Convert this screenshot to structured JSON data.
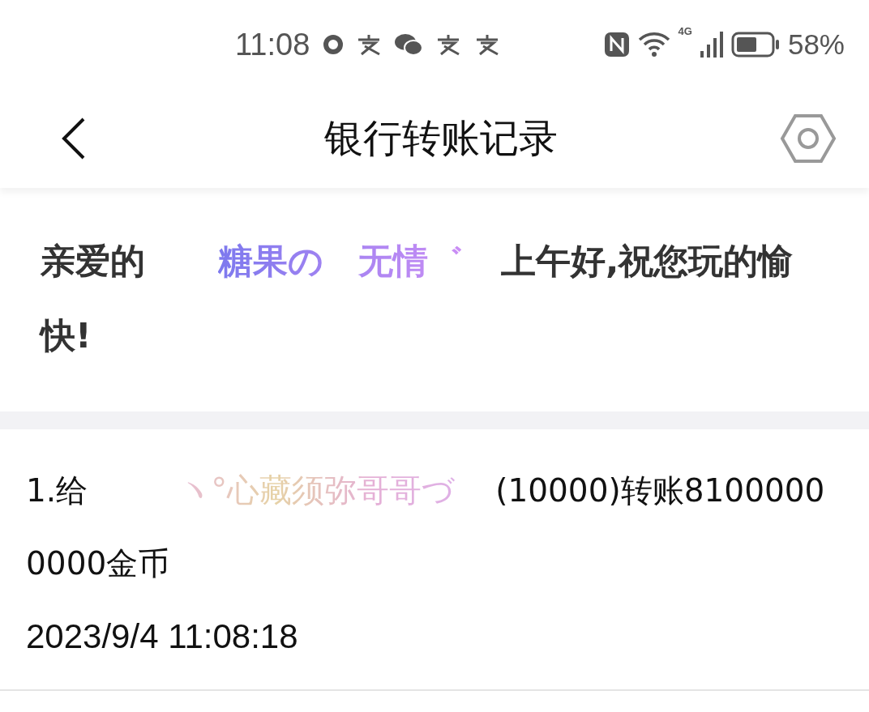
{
  "status_bar": {
    "time": "11:08",
    "battery": "58%",
    "network": "4G"
  },
  "header": {
    "title": "银行转账记录"
  },
  "greeting": {
    "prefix": "亲爱的",
    "name": "糖果の　无情゛",
    "suffix": "上午好,祝您玩的愉快!"
  },
  "records": [
    {
      "prefix": "1.给",
      "name": "ヽ°心藏须弥哥哥づ",
      "detail": "(10000)转账81000000000金币",
      "date": "2023/9/4 11:08:18"
    }
  ]
}
